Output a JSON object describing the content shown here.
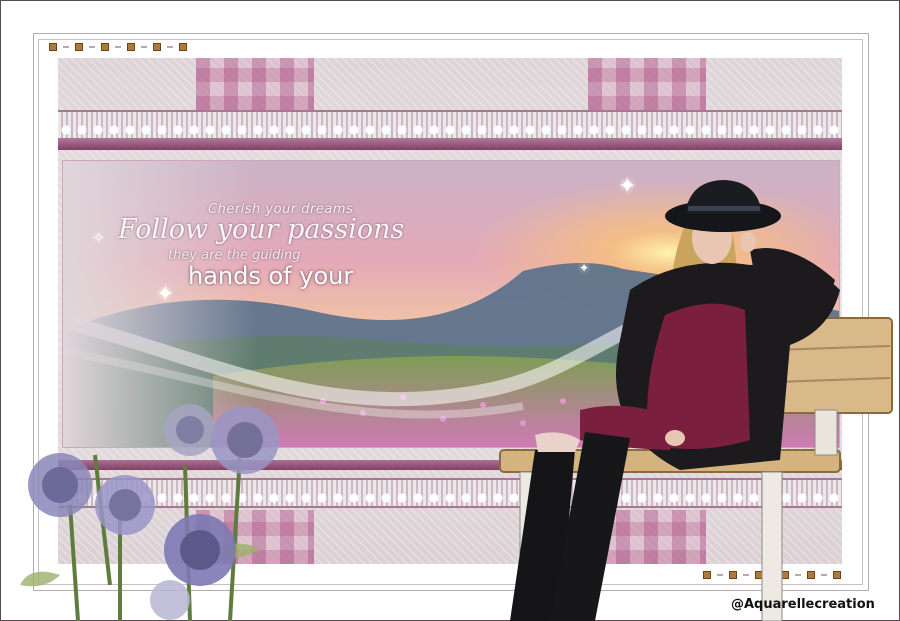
{
  "artwork": {
    "quote": {
      "line1": "Cherish your dreams",
      "line2": "Follow your passions",
      "line3": "they are the guiding",
      "line4": "hands of your"
    },
    "signature": "@Aquarellecreation"
  },
  "colors": {
    "accent_mauve": "#9c4f7a",
    "background_taupe": "#e2dadd",
    "lace_white": "#f5eff2"
  },
  "icons": [
    "sparkle-icon",
    "dot-ornament-icon"
  ]
}
